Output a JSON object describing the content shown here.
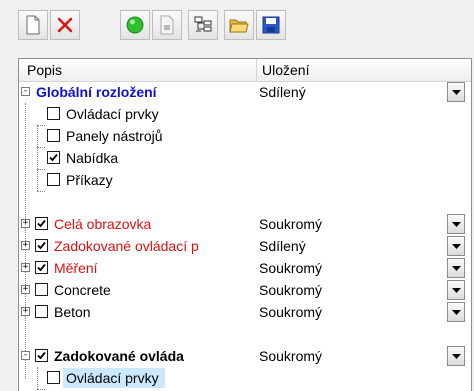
{
  "toolbar": {
    "buttons": [
      {
        "name": "new-document-icon"
      },
      {
        "name": "delete-icon"
      },
      {
        "name": "green-circle-icon"
      },
      {
        "name": "export-icon"
      },
      {
        "name": "tree-structure-icon"
      },
      {
        "name": "open-folder-icon"
      },
      {
        "name": "save-icon"
      }
    ]
  },
  "columns": {
    "description": "Popis",
    "storage": "Uložení"
  },
  "rows": [
    {
      "label": "Globální rozložení",
      "value": "Sdílený",
      "style": "blue",
      "expand": "-",
      "checkbox": false,
      "dropdown": true
    },
    {
      "label": "Ovládací prvky",
      "value": "",
      "style": "normal",
      "checked": false,
      "dropdown": false
    },
    {
      "label": "Panely nástrojů",
      "value": "",
      "style": "normal",
      "checked": false,
      "dropdown": false
    },
    {
      "label": "Nabídka",
      "value": "",
      "style": "normal",
      "checked": true,
      "dropdown": false
    },
    {
      "label": "Příkazy",
      "value": "",
      "style": "normal",
      "checked": false,
      "dropdown": false
    },
    {
      "label": "Celá obrazovka",
      "value": "Soukromý",
      "style": "red",
      "expand": "+",
      "checked": true,
      "dropdown": true
    },
    {
      "label": "Zadokované ovládací p",
      "value": "Sdílený",
      "style": "red",
      "expand": "+",
      "checked": true,
      "dropdown": true
    },
    {
      "label": "Měření",
      "value": "Soukromý",
      "style": "red",
      "expand": "+",
      "checked": true,
      "dropdown": true
    },
    {
      "label": "Concrete",
      "value": "Soukromý",
      "style": "normal",
      "expand": "+",
      "checked": false,
      "dropdown": true
    },
    {
      "label": "Beton",
      "value": "Soukromý",
      "style": "normal",
      "expand": "+",
      "checked": false,
      "dropdown": true
    },
    {
      "label": "Zadokované ovláda",
      "value": "Soukromý",
      "style": "bold",
      "expand": "-",
      "checked": true,
      "dropdown": true
    },
    {
      "label": "Ovládací prvky",
      "value": "",
      "style": "normal",
      "checked": false,
      "dropdown": false,
      "selected": true
    }
  ]
}
